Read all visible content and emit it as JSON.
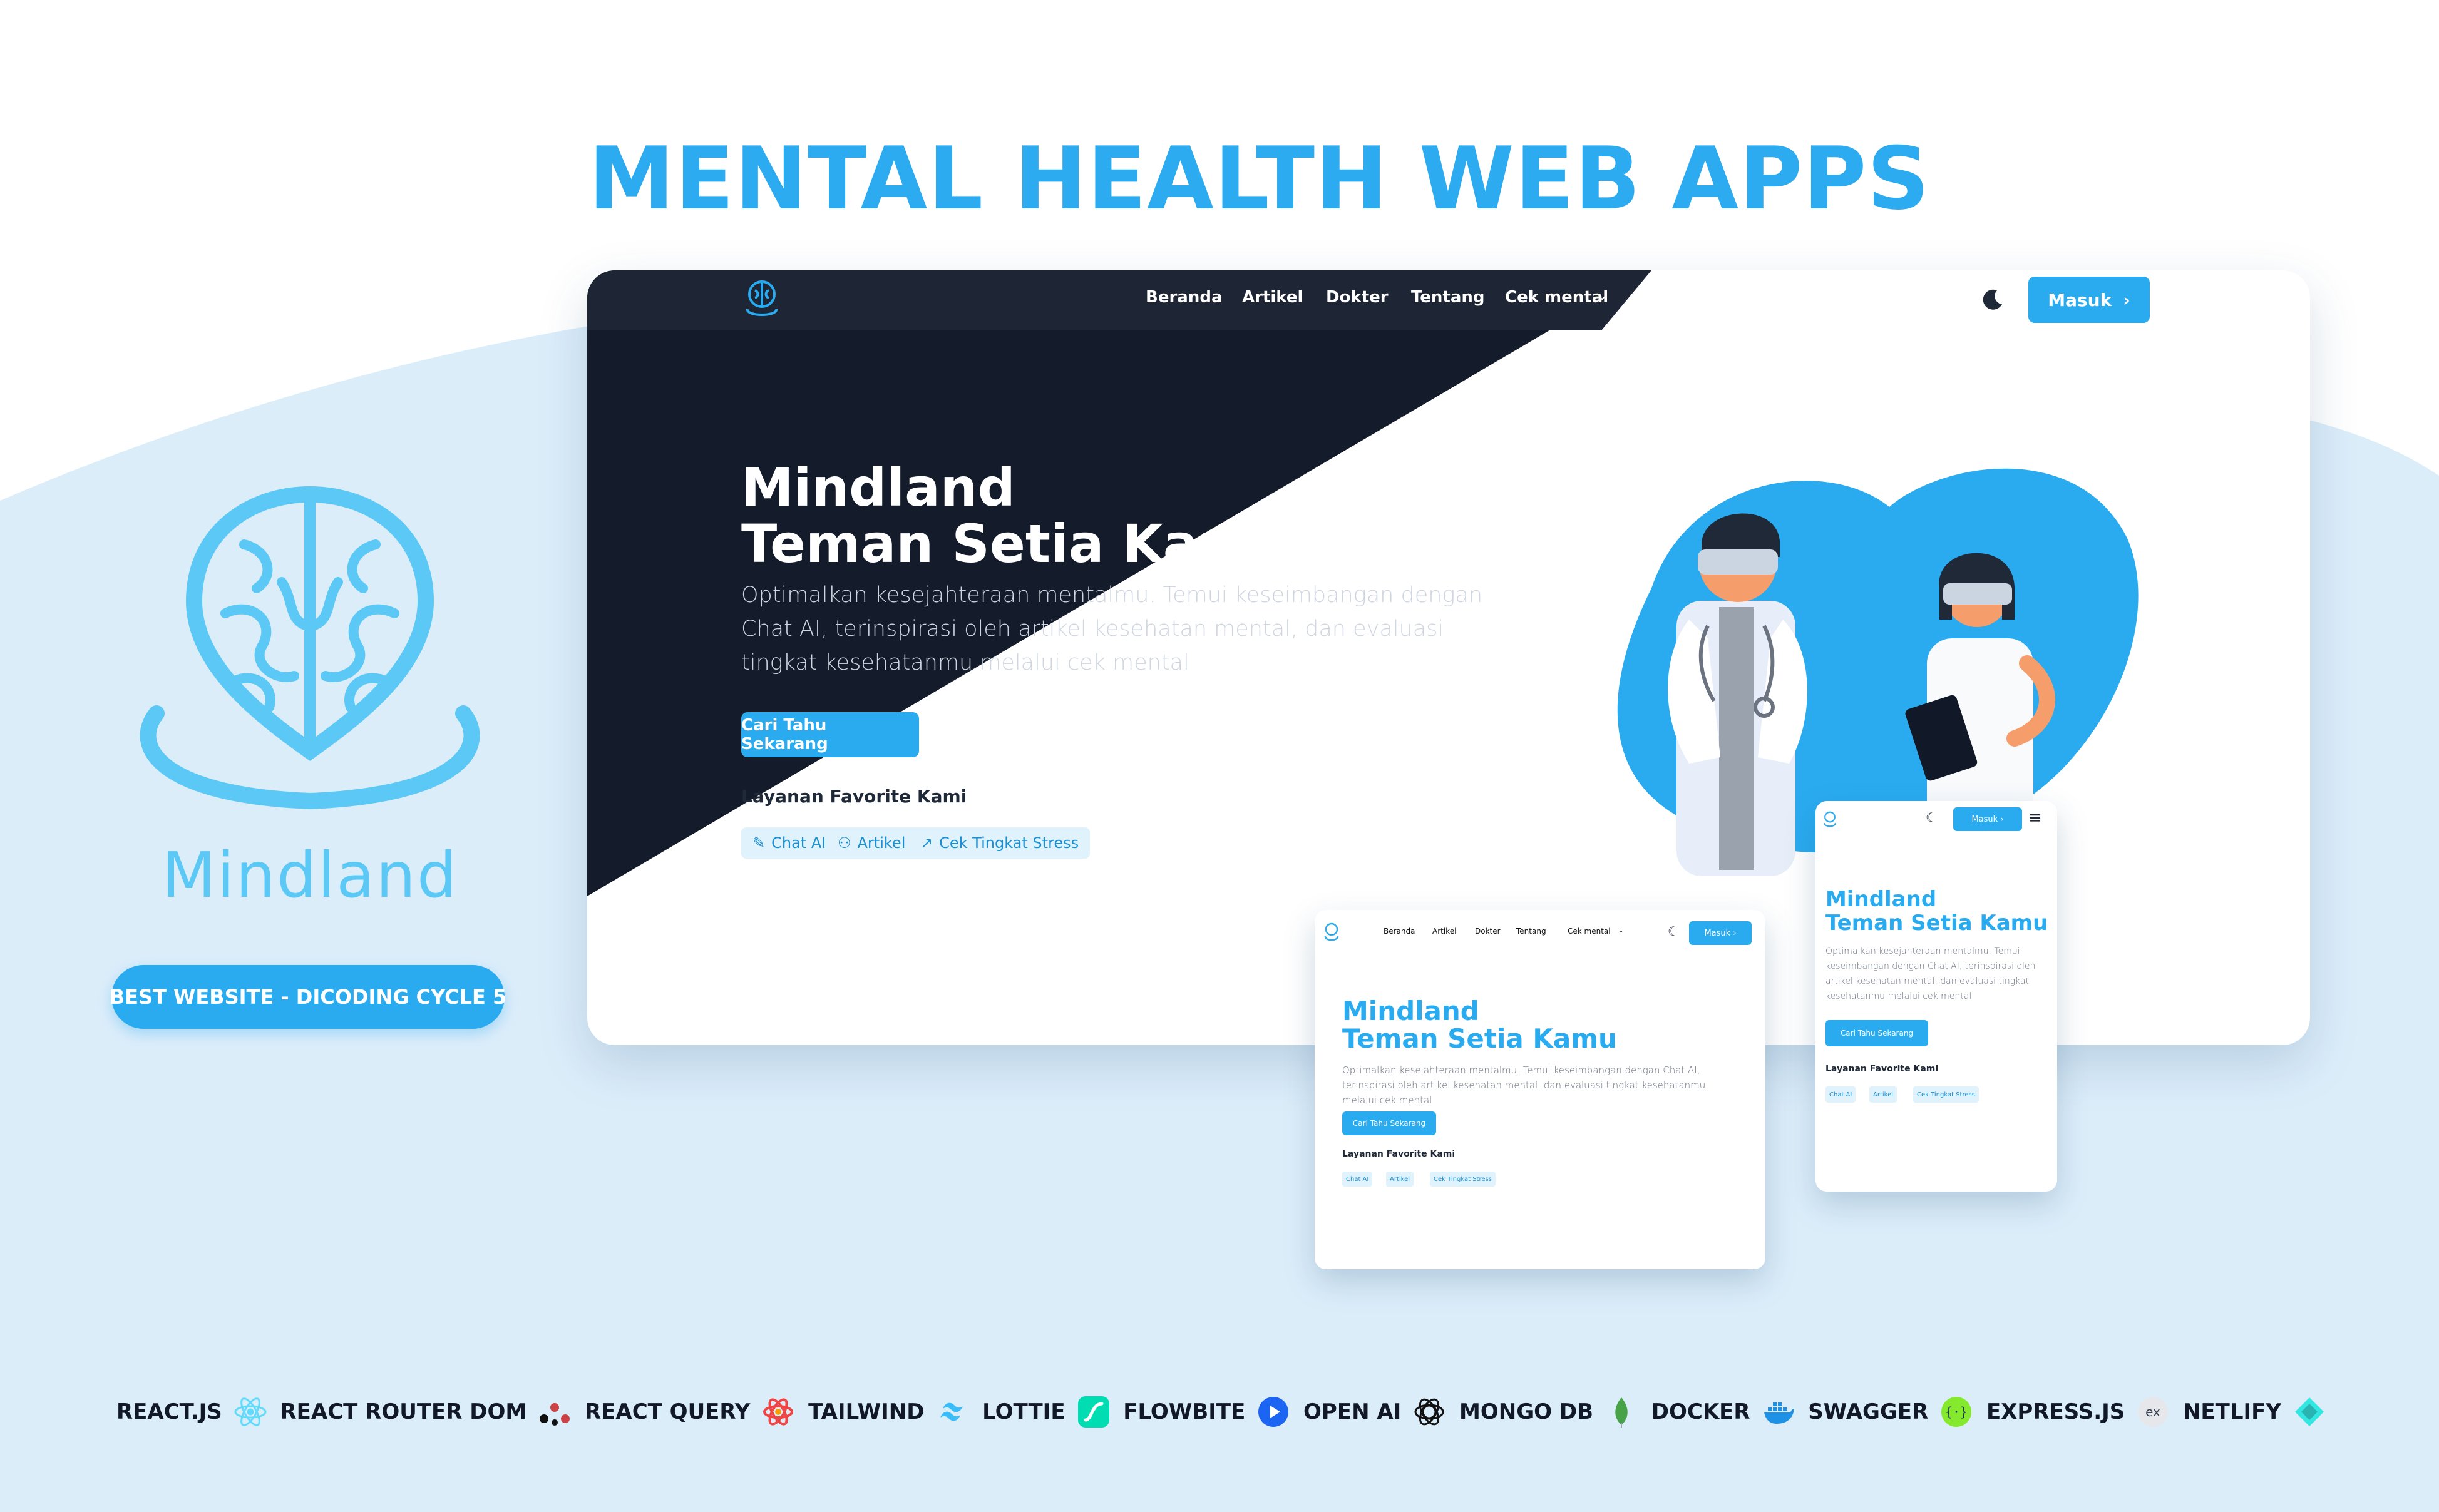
{
  "headline": "MENTAL HEALTH WEB APPS",
  "brand": {
    "name": "Mindland",
    "award": "BEST WEBSITE  - DICODING CYCLE 5"
  },
  "desktop": {
    "nav": {
      "links": [
        "Beranda",
        "Artikel",
        "Dokter",
        "Tentang",
        "Cek mental"
      ],
      "login": "Masuk"
    },
    "hero": {
      "title_line1": "Mindland",
      "title_line2": "Teman Setia Kamu",
      "description": "Optimalkan kesejahteraan mentalmu. Temui keseimbangan dengan Chat AI, terinspirasi oleh artikel kesehatan mental, dan evaluasi tingkat kesehatanmu melalui cek mental",
      "cta": "Cari Tahu Sekarang",
      "favorites_title": "Layanan Favorite Kami",
      "chips": [
        "Chat AI",
        "Artikel",
        "Cek Tingkat Stress"
      ]
    }
  },
  "tablet": {
    "nav": {
      "links": [
        "Beranda",
        "Artikel",
        "Dokter",
        "Tentang",
        "Cek mental"
      ],
      "login": "Masuk"
    },
    "hero": {
      "title_line1": "Mindland",
      "title_line2": "Teman Setia Kamu",
      "description": "Optimalkan kesejahteraan mentalmu. Temui keseimbangan dengan Chat AI, terinspirasi oleh artikel kesehatan mental, dan evaluasi tingkat kesehatanmu melalui cek mental",
      "cta": "Cari Tahu Sekarang",
      "favorites_title": "Layanan Favorite Kami",
      "chips": [
        "Chat AI",
        "Artikel",
        "Cek Tingkat Stress"
      ]
    }
  },
  "phone": {
    "nav": {
      "login": "Masuk"
    },
    "hero": {
      "title_line1": "Mindland",
      "title_line2": "Teman Setia Kamu",
      "description": "Optimalkan kesejahteraan mentalmu. Temui keseimbangan dengan Chat AI, terinspirasi oleh artikel kesehatan mental, dan evaluasi tingkat kesehatanmu melalui cek mental",
      "cta": "Cari Tahu Sekarang",
      "favorites_title": "Layanan Favorite Kami",
      "chips": [
        "Chat AI",
        "Artikel",
        "Cek Tingkat Stress"
      ]
    }
  },
  "tech_stack": [
    {
      "label": "REACT.JS",
      "icon": "react-icon"
    },
    {
      "label": "REACT ROUTER DOM",
      "icon": "react-router-icon"
    },
    {
      "label": "REACT QUERY",
      "icon": "react-query-icon"
    },
    {
      "label": "TAILWIND",
      "icon": "tailwind-icon"
    },
    {
      "label": "LOTTIE",
      "icon": "lottie-icon"
    },
    {
      "label": "FLOWBITE",
      "icon": "flowbite-icon"
    },
    {
      "label": "OPEN AI",
      "icon": "openai-icon"
    },
    {
      "label": "MONGO DB",
      "icon": "mongodb-icon"
    },
    {
      "label": "DOCKER",
      "icon": "docker-icon"
    },
    {
      "label": "SWAGGER",
      "icon": "swagger-icon"
    },
    {
      "label": "EXPRESS.JS",
      "icon": "express-icon"
    },
    {
      "label": "NETLIFY",
      "icon": "netlify-icon"
    }
  ],
  "colors": {
    "accent": "#2aabf0",
    "dark": "#141c2b",
    "background_blob": "#dbeefb"
  }
}
